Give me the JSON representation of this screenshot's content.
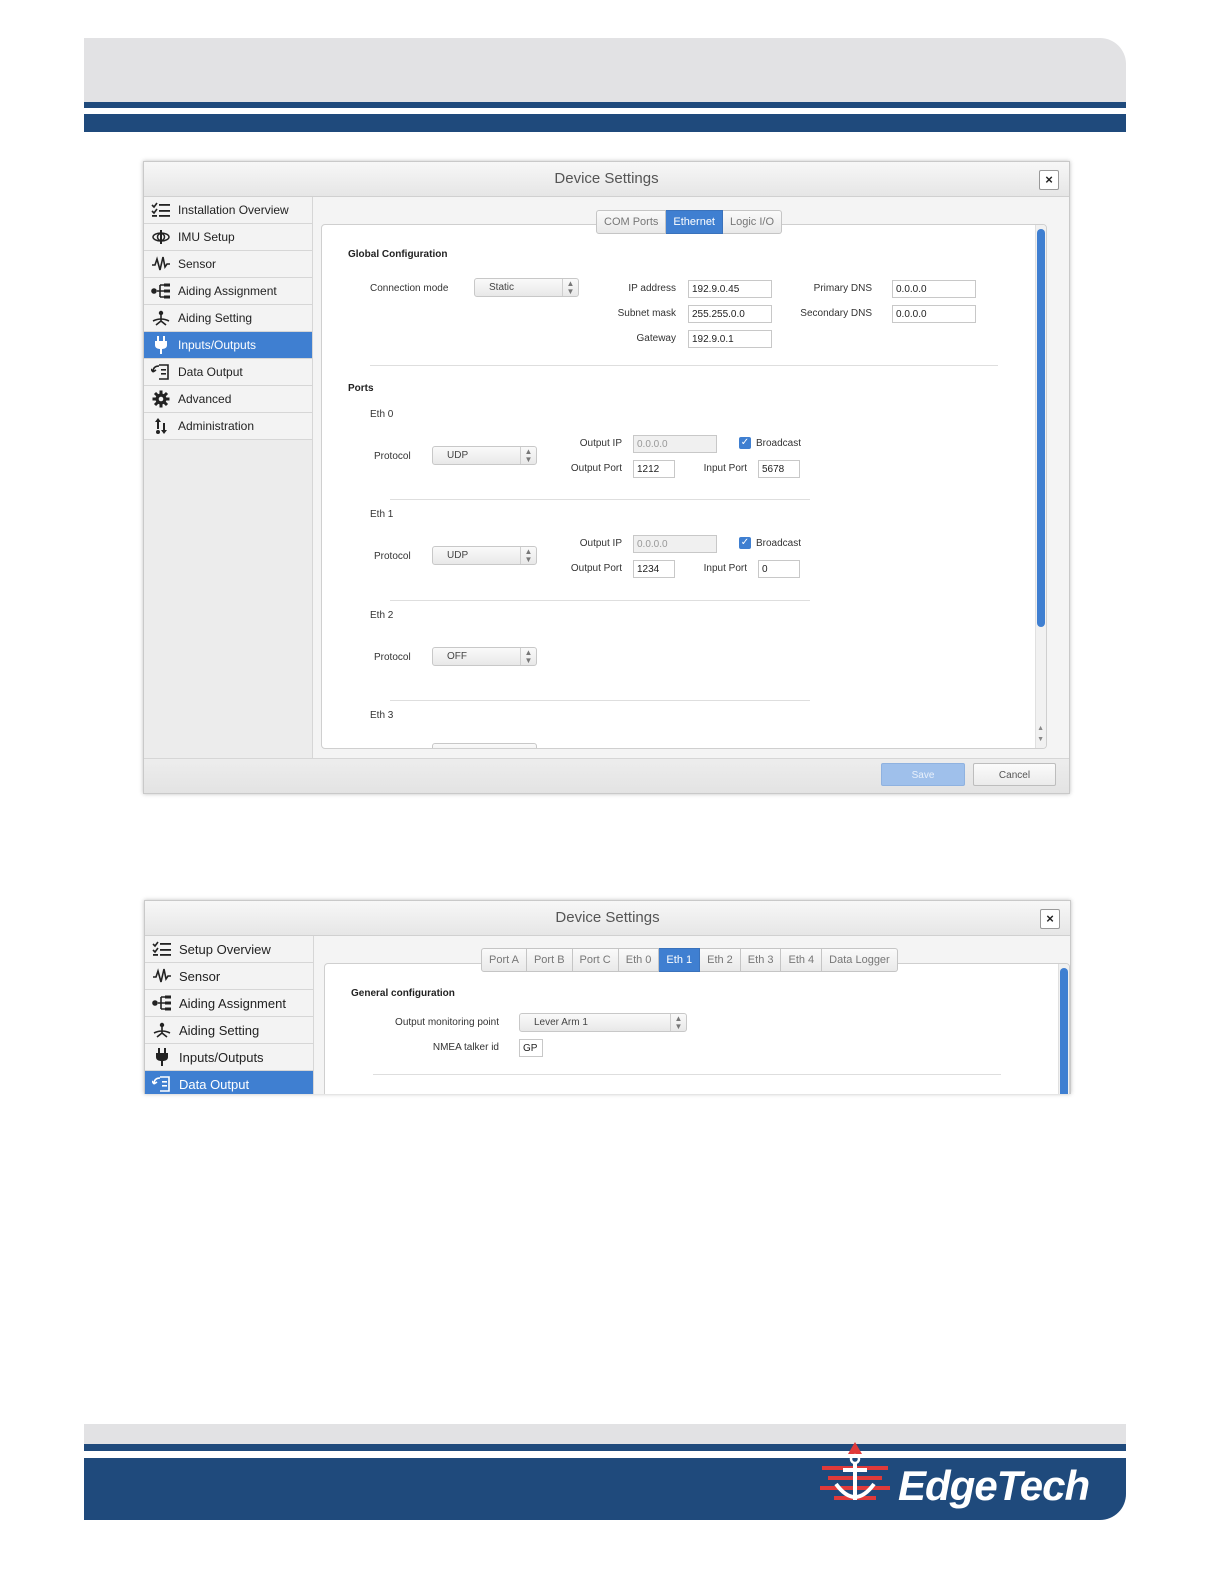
{
  "colors": {
    "brand_blue": "#1f4a7c",
    "accent": "#3f7fd1",
    "logo_red": "#e03a3a"
  },
  "footer": {
    "logo_text": "EdgeTech",
    "logo_icon": "anchor-logo-icon"
  },
  "dialog1": {
    "title": "Device Settings",
    "close": "×",
    "sidebar": [
      {
        "label": "Installation Overview",
        "icon": "checklist-icon"
      },
      {
        "label": "IMU Setup",
        "icon": "imu-icon"
      },
      {
        "label": "Sensor",
        "icon": "waveform-icon"
      },
      {
        "label": "Aiding Assignment",
        "icon": "tree-icon"
      },
      {
        "label": "Aiding Setting",
        "icon": "aiding-icon"
      },
      {
        "label": "Inputs/Outputs",
        "icon": "plug-icon",
        "active": true
      },
      {
        "label": "Data Output",
        "icon": "output-icon"
      },
      {
        "label": "Advanced",
        "icon": "gear-icon"
      },
      {
        "label": "Administration",
        "icon": "admin-icon"
      }
    ],
    "tabs": [
      "COM Ports",
      "Ethernet",
      "Logic I/O"
    ],
    "active_tab": "Ethernet",
    "global": {
      "heading": "Global Configuration",
      "connection_mode_label": "Connection mode",
      "connection_mode_value": "Static",
      "ip_label": "IP address",
      "ip_value": "192.9.0.45",
      "subnet_label": "Subnet mask",
      "subnet_value": "255.255.0.0",
      "gateway_label": "Gateway",
      "gateway_value": "192.9.0.1",
      "primary_dns_label": "Primary DNS",
      "primary_dns_value": "0.0.0.0",
      "secondary_dns_label": "Secondary DNS",
      "secondary_dns_value": "0.0.0.0"
    },
    "ports_heading": "Ports",
    "ports": [
      {
        "name": "Eth 0",
        "protocol_label": "Protocol",
        "protocol": "UDP",
        "output_ip_label": "Output IP",
        "output_ip": "0.0.0.0",
        "broadcast_label": "Broadcast",
        "broadcast": true,
        "output_port_label": "Output Port",
        "output_port": "1212",
        "input_port_label": "Input Port",
        "input_port": "5678"
      },
      {
        "name": "Eth 1",
        "protocol_label": "Protocol",
        "protocol": "UDP",
        "output_ip_label": "Output IP",
        "output_ip": "0.0.0.0",
        "broadcast_label": "Broadcast",
        "broadcast": true,
        "output_port_label": "Output Port",
        "output_port": "1234",
        "input_port_label": "Input Port",
        "input_port": "0"
      },
      {
        "name": "Eth 2",
        "protocol_label": "Protocol",
        "protocol": "OFF"
      },
      {
        "name": "Eth 3"
      }
    ],
    "save_label": "Save",
    "cancel_label": "Cancel"
  },
  "dialog2": {
    "title": "Device Settings",
    "close": "×",
    "sidebar": [
      {
        "label": "Setup Overview",
        "icon": "checklist-icon"
      },
      {
        "label": "Sensor",
        "icon": "waveform-icon"
      },
      {
        "label": "Aiding Assignment",
        "icon": "tree-icon"
      },
      {
        "label": "Aiding Setting",
        "icon": "aiding-icon"
      },
      {
        "label": "Inputs/Outputs",
        "icon": "plug-icon"
      },
      {
        "label": "Data Output",
        "icon": "output-icon",
        "active": true
      }
    ],
    "tabs": [
      "Port A",
      "Port B",
      "Port C",
      "Eth 0",
      "Eth 1",
      "Eth 2",
      "Eth 3",
      "Eth 4",
      "Data Logger"
    ],
    "active_tab": "Eth 1",
    "general": {
      "heading": "General configuration",
      "monitor_label": "Output monitoring point",
      "monitor_value": "Lever Arm 1",
      "talker_label": "NMEA talker id",
      "talker_value": "GP"
    }
  }
}
